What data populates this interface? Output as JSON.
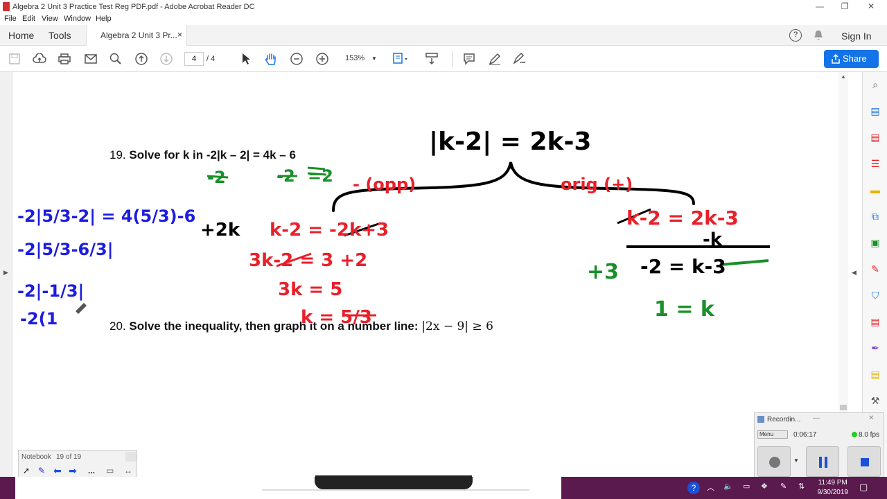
{
  "window": {
    "title": "Algebra 2 Unit 3 Practice Test Reg PDF.pdf - Adobe Acrobat Reader DC"
  },
  "menu": [
    "File",
    "Edit",
    "View",
    "Window",
    "Help"
  ],
  "tabs": {
    "home": "Home",
    "tools": "Tools",
    "document": "Algebra 2 Unit 3 Pr...",
    "close": "×",
    "sign_in": "Sign In"
  },
  "toolbar": {
    "current_page": "4",
    "total_pages": "/ 4",
    "zoom": "153%",
    "share_label": "Share"
  },
  "document": {
    "q19_num": "19.",
    "q19_text": "Solve for k in -2|k – 2| = 4k – 6",
    "q20_num": "20.",
    "q20_text": "Solve the inequality, then graph it on a number line:",
    "q20_math": "|2x − 9| ≥ 6"
  },
  "handwriting": {
    "top_equation": "|k-2| = 2k-3",
    "neg_label": "- (opp)",
    "pos_label": "orig (+)",
    "step_plus2k": "+2k",
    "left_line1": "k-2 = -2k+3",
    "left_line2": "3k-2 = 3 +2",
    "left_line3": "3k = 5",
    "left_line4": "k = 5/3",
    "right_line1": "k-2 = 2k-3",
    "right_minus_k": "-k",
    "right_line2": "-2 = k-3",
    "right_plus3": "+3",
    "right_result": "1 = k",
    "minus2_a": "-2",
    "minus2_b": "-2",
    "minus2_c": "=2",
    "blue_line1": "-2|5/3-2| = 4(5/3)-6",
    "blue_line2": "-2|5/3-6/3|",
    "blue_line3": "-2|-1/3|",
    "blue_line4": "-2(1"
  },
  "notebook": {
    "label": "Notebook",
    "count": "19 of 19",
    "more": "..."
  },
  "recorder": {
    "title": "Recordin...",
    "menu": "Menu",
    "elapsed": "0:06:17",
    "fps": "8.0 fps"
  },
  "taskbar": {
    "time": "11:49 PM",
    "date": "9/30/2019"
  },
  "colors": {
    "share": "#1473e6",
    "ink_black": "#000000",
    "ink_red": "#e8202a",
    "ink_green": "#1a8f2a",
    "ink_blue": "#1c1ce0",
    "taskbar": "#5a1a4e"
  }
}
